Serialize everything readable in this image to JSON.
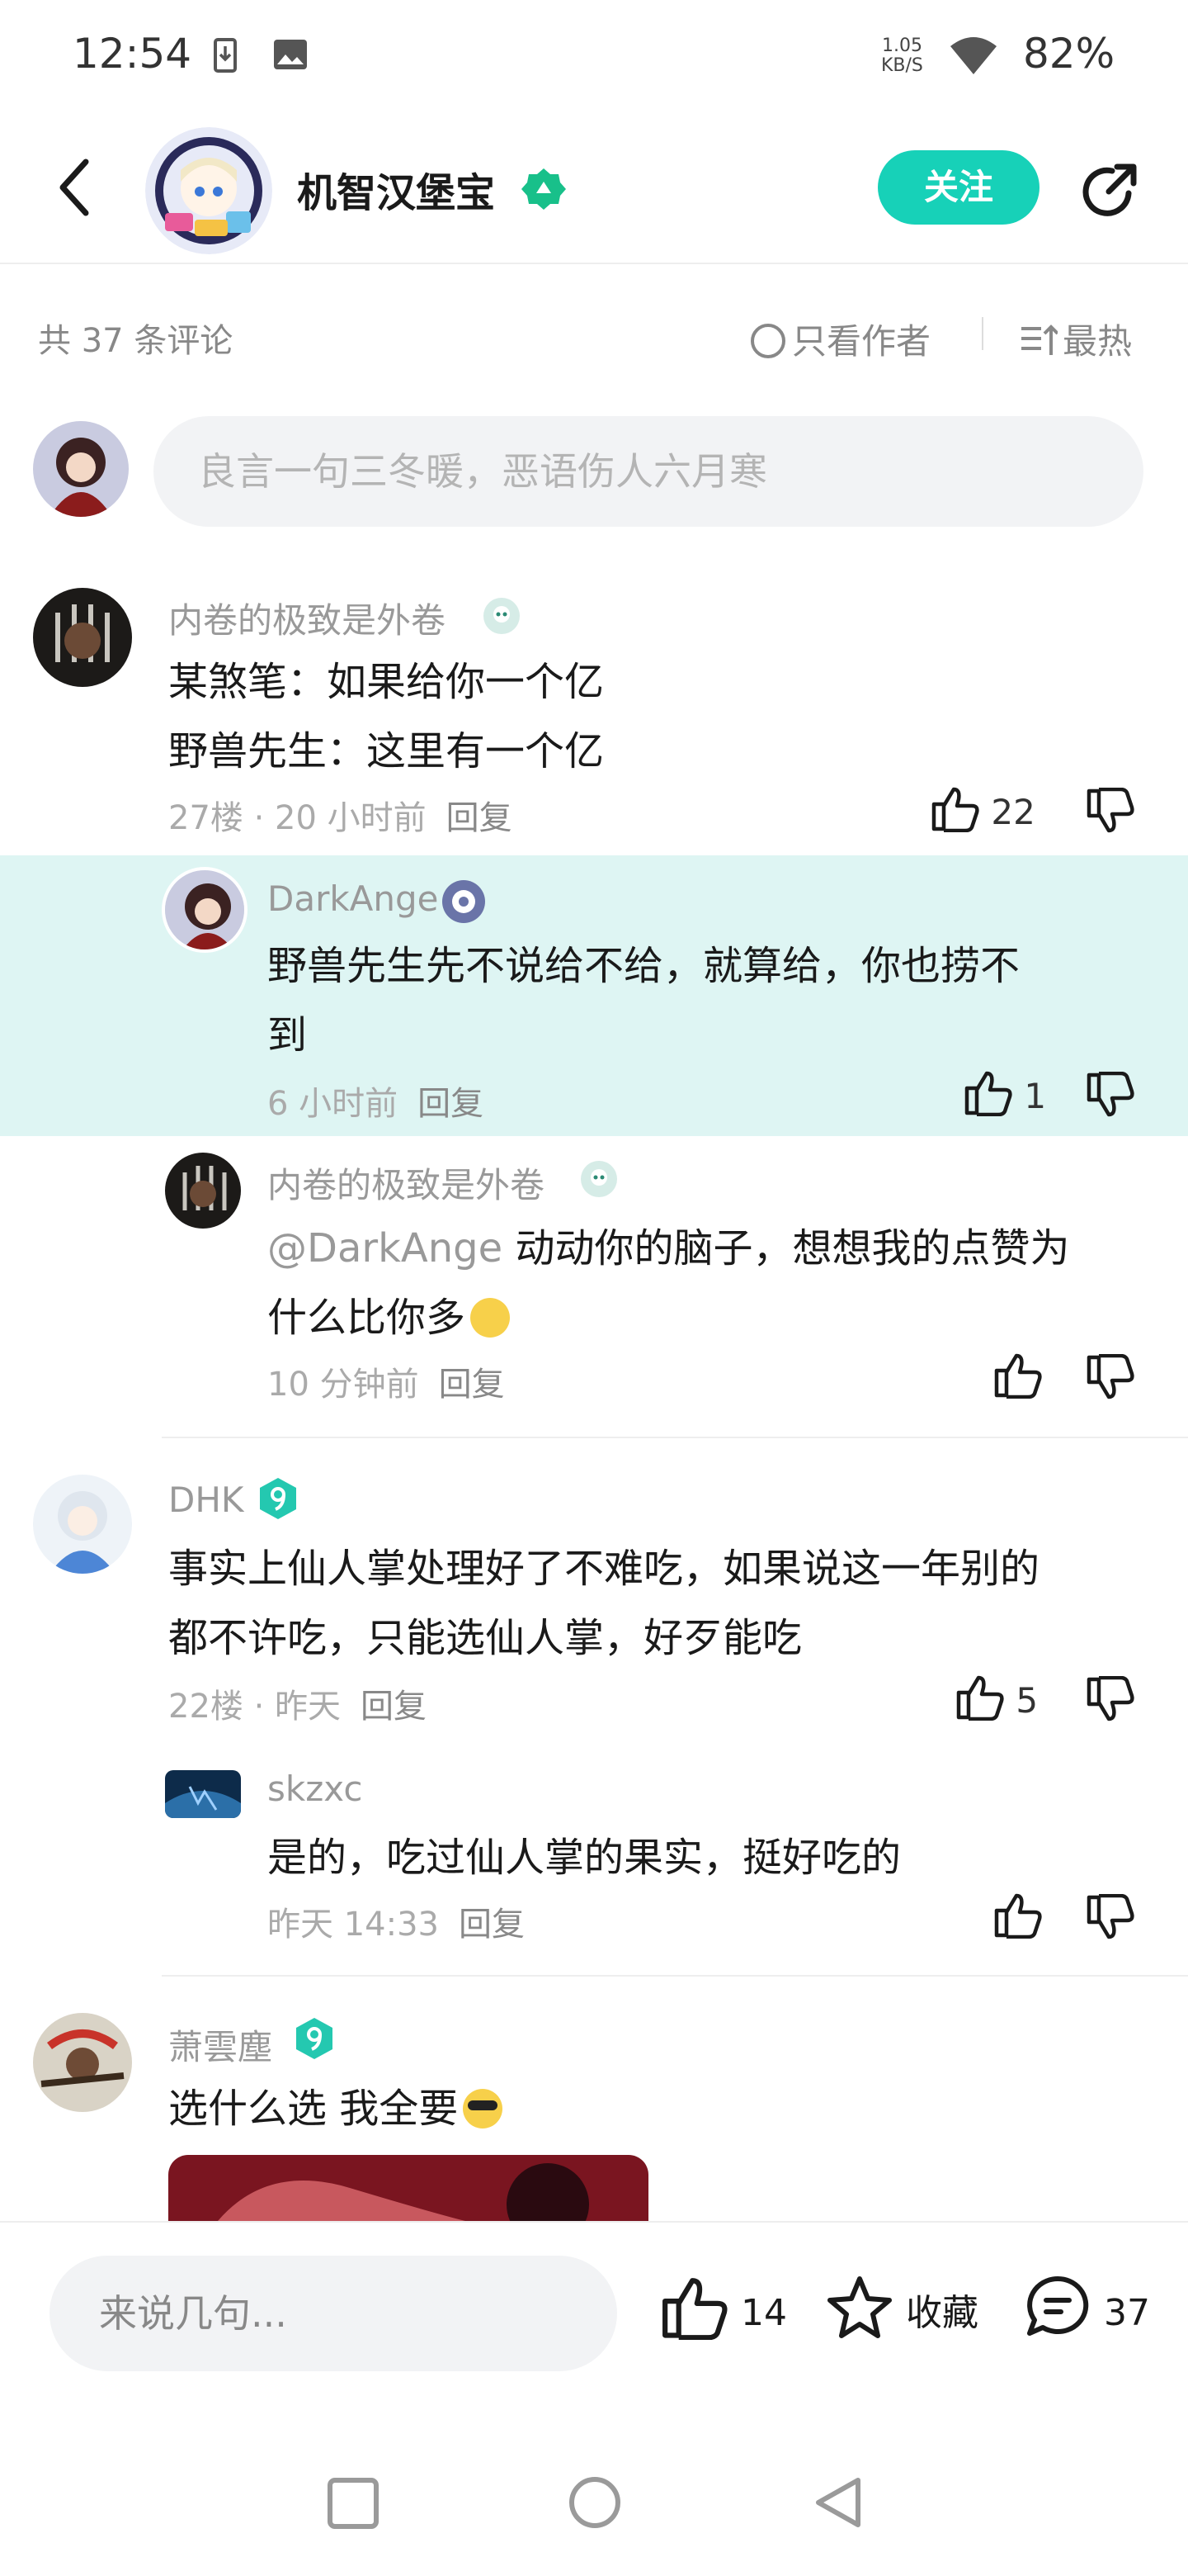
{
  "status_bar": {
    "time": "12:54",
    "speed_value": "1.05",
    "speed_unit": "KB/S",
    "battery": "82%"
  },
  "header": {
    "title": "机智汉堡宝",
    "follow_label": "关注"
  },
  "toolbar": {
    "comment_count": "共 37 条评论",
    "only_author": "只看作者",
    "sort": "最热"
  },
  "composer": {
    "placeholder": "良言一句三冬暖，恶语伤人六月寒"
  },
  "comments": [
    {
      "user": "内卷的极致是外卷",
      "text_lines": [
        "某煞笔：如果给你一个亿",
        "野兽先生：这里有一个亿"
      ],
      "floor": "27楼 · 20 小时前",
      "reply": "回复",
      "likes": "22",
      "replies": [
        {
          "user": "DarkAnge",
          "text_lines": [
            "野兽先生先不说给不给，就算给，你也捞不",
            "到"
          ],
          "time": "6 小时前",
          "reply": "回复",
          "likes": "1"
        },
        {
          "user": "内卷的极致是外卷",
          "mention": "@DarkAnge",
          "text_lines": [
            "动动你的脑子，想想我的点赞为",
            "什么比你多"
          ],
          "time": "10 分钟前",
          "reply": "回复",
          "likes": ""
        }
      ]
    },
    {
      "user": "DHK",
      "text_lines": [
        "事实上仙人掌处理好了不难吃，如果说这一年别的",
        "都不许吃，只能选仙人掌，好歹能吃"
      ],
      "floor": "22楼 · 昨天",
      "reply": "回复",
      "likes": "5",
      "replies": [
        {
          "user": "skzxc",
          "text_lines": [
            "是的，吃过仙人掌的果实，挺好吃的"
          ],
          "time": "昨天 14:33",
          "reply": "回复",
          "likes": ""
        }
      ]
    },
    {
      "user": "萧雲塵",
      "text_lines": [
        "选什么选 我全要"
      ],
      "floor": "",
      "reply": "",
      "likes": ""
    }
  ],
  "bottom_bar": {
    "placeholder": "来说几句...",
    "likes": "14",
    "favorite": "收藏",
    "comments": "37"
  },
  "colors": {
    "accent": "#17d1b8",
    "highlight": "#def5f3"
  }
}
